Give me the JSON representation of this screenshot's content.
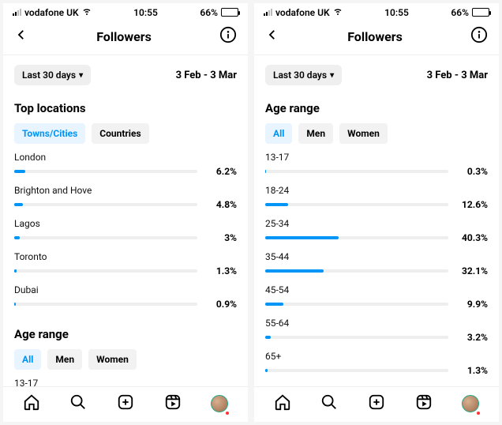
{
  "status": {
    "carrier": "vodafone UK",
    "time": "10:55",
    "battery_pct": "66%"
  },
  "header": {
    "title": "Followers"
  },
  "controls": {
    "range_chip": "Last 30 days",
    "date_range": "3 Feb - 3 Mar"
  },
  "sections": {
    "top_locations": {
      "title": "Top locations",
      "tabs": {
        "towns": "Towns/Cities",
        "countries": "Countries"
      }
    },
    "age_range": {
      "title": "Age range",
      "tabs": {
        "all": "All",
        "men": "Men",
        "women": "Women"
      }
    }
  },
  "chart_data": [
    {
      "type": "bar",
      "title": "Top locations",
      "orientation": "horizontal",
      "xlabel": "",
      "ylabel": "",
      "xlim": [
        0,
        100
      ],
      "unit": "%",
      "categories": [
        "London",
        "Brighton and Hove",
        "Lagos",
        "Toronto",
        "Dubai"
      ],
      "values": [
        6.2,
        4.8,
        3,
        1.3,
        0.9
      ],
      "display_values": [
        "6.2%",
        "4.8%",
        "3%",
        "1.3%",
        "0.9%"
      ]
    },
    {
      "type": "bar",
      "title": "Age range",
      "orientation": "horizontal",
      "xlabel": "",
      "ylabel": "",
      "xlim": [
        0,
        100
      ],
      "unit": "%",
      "categories": [
        "13-17",
        "18-24",
        "25-34",
        "35-44",
        "45-54",
        "55-64",
        "65+"
      ],
      "values": [
        0.3,
        12.6,
        40.3,
        32.1,
        9.9,
        3.2,
        1.3
      ],
      "display_values": [
        "0.3%",
        "12.6%",
        "40.3%",
        "32.1%",
        "9.9%",
        "3.2%",
        "1.3%"
      ]
    }
  ]
}
